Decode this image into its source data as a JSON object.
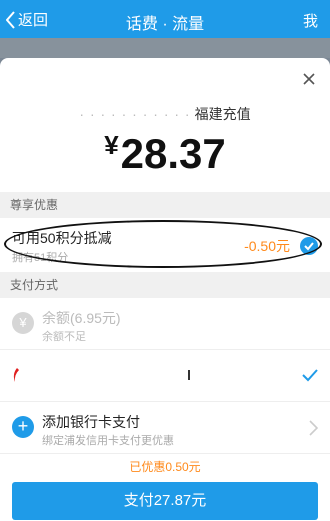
{
  "topbar": {
    "back_label": "返回",
    "title": "话费 · 流量",
    "me_label": "我"
  },
  "sheet": {
    "merchant_dots": "· · · · · · · · · · ·",
    "merchant_name": "福建充值",
    "currency": "¥",
    "amount": "28.37",
    "section_discount": "尊享优惠",
    "points": {
      "label": "可用50积分抵减",
      "owned": "拥有51积分",
      "discount": "-0.50元",
      "checked": true
    },
    "section_pay": "支付方式",
    "balance": {
      "label": "余额(6.95元)",
      "note": "余额不足",
      "icon_glyph": "¥"
    },
    "bank": {
      "selected": true
    },
    "add_card": {
      "icon_glyph": "+",
      "label": "添加银行卡支付",
      "note": "绑定浦发信用卡支付更优惠"
    },
    "saved_text": "已优惠0.50元",
    "pay_button": "支付27.87元"
  },
  "colors": {
    "accent": "#1f9be8",
    "discount": "#ff8a1c"
  }
}
